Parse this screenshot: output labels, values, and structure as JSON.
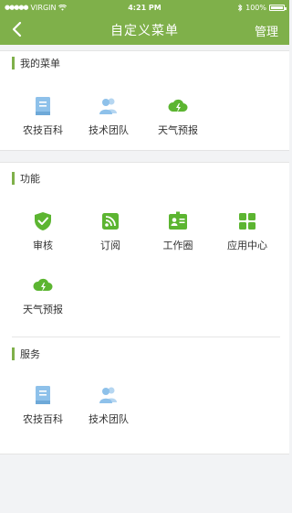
{
  "status_bar": {
    "carrier": "VIRGIN",
    "time": "4:21 PM",
    "battery": "100%"
  },
  "nav": {
    "title": "自定义菜单",
    "manage_label": "管理"
  },
  "my_menu": {
    "heading": "我的菜单",
    "items": [
      {
        "label": "农技百科",
        "icon": "book-icon"
      },
      {
        "label": "技术团队",
        "icon": "team-icon"
      },
      {
        "label": "天气预报",
        "icon": "weather-icon"
      }
    ]
  },
  "functions": {
    "heading": "功能",
    "items": [
      {
        "label": "审核",
        "icon": "shield-check-icon"
      },
      {
        "label": "订阅",
        "icon": "rss-icon"
      },
      {
        "label": "工作圈",
        "icon": "id-card-icon"
      },
      {
        "label": "应用中心",
        "icon": "grid-icon"
      },
      {
        "label": "天气预报",
        "icon": "weather-icon"
      }
    ]
  },
  "services": {
    "heading": "服务",
    "items": [
      {
        "label": "农技百科",
        "icon": "book-icon"
      },
      {
        "label": "技术团队",
        "icon": "team-icon"
      }
    ]
  },
  "colors": {
    "brand_green": "#7fb04a",
    "icon_green": "#5cb531",
    "icon_blue": "#8ec1ea"
  }
}
